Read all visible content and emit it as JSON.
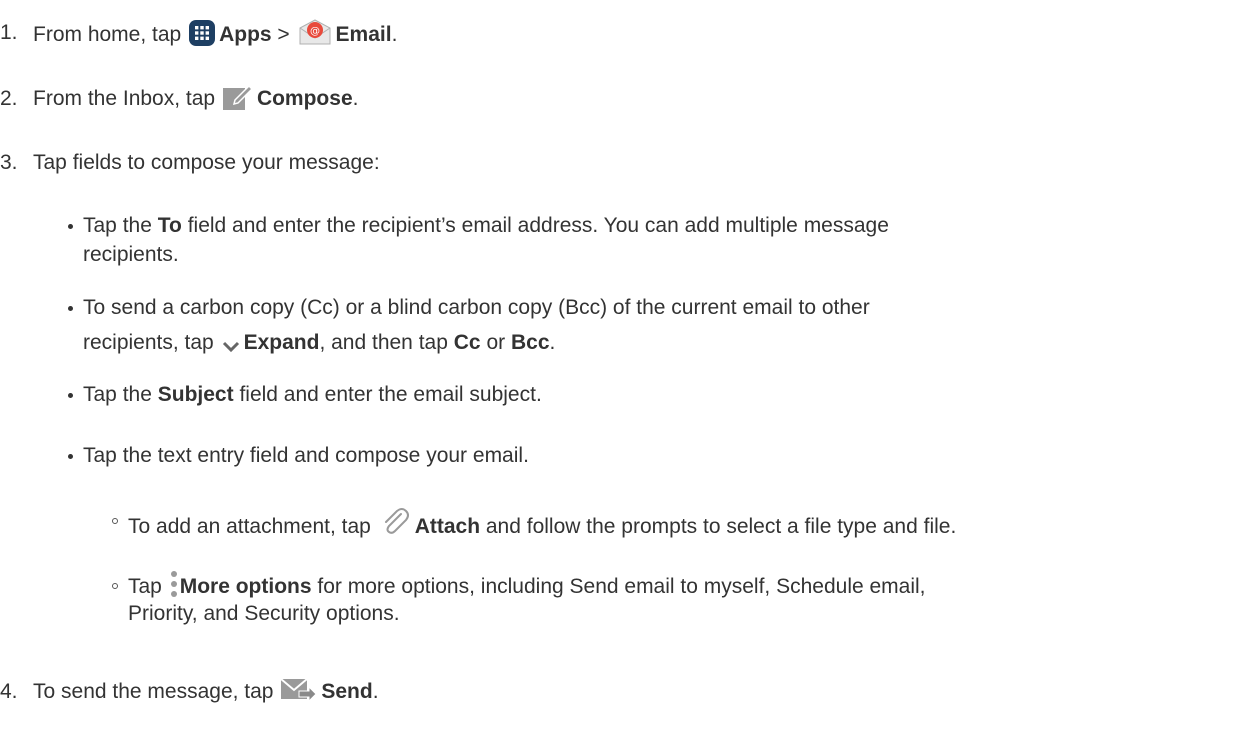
{
  "steps": [
    {
      "num": "1.",
      "t1": "From home, tap",
      "b1": "Apps",
      "t2": ">",
      "b2": "Email",
      "t3": "."
    },
    {
      "num": "2.",
      "t1": "From the Inbox, tap",
      "b1": "Compose",
      "t2": "."
    },
    {
      "num": "3.",
      "t1": "Tap fields to compose your message:"
    },
    {
      "num": "4.",
      "t1": "To send the message, tap",
      "b1": "Send",
      "t2": "."
    }
  ],
  "bullets": {
    "to_field": {
      "t1": "Tap the",
      "b1": "To",
      "t2": "field and enter the recipient’s email address. You can add multiple message",
      "t3": "recipients."
    },
    "cc_bcc": {
      "t1": "To send a carbon copy (Cc) or a blind carbon copy (Bcc) of the current email to other",
      "t2": "recipients, tap",
      "b1": "Expand",
      "t3": ", and then tap",
      "b2": "Cc",
      "t4": "or",
      "b3": "Bcc",
      "t5": "."
    },
    "subject": {
      "t1": "Tap the",
      "b1": "Subject",
      "t2": "field and enter the email subject."
    },
    "text_entry": {
      "t1": "Tap the text entry field and compose your email."
    }
  },
  "subbullets": {
    "attach": {
      "t1": "To add an attachment, tap",
      "b1": "Attach",
      "t2": "and follow the prompts to select a file type and file."
    },
    "more": {
      "t1": "Tap",
      "b1": "More options",
      "t2": "for more options, including Send email to myself, Schedule email,",
      "t3": "Priority, and Security options."
    }
  },
  "icons": [
    "apps-icon",
    "email-icon",
    "compose-icon",
    "expand-icon",
    "attach-icon",
    "more-options-icon",
    "send-icon"
  ]
}
